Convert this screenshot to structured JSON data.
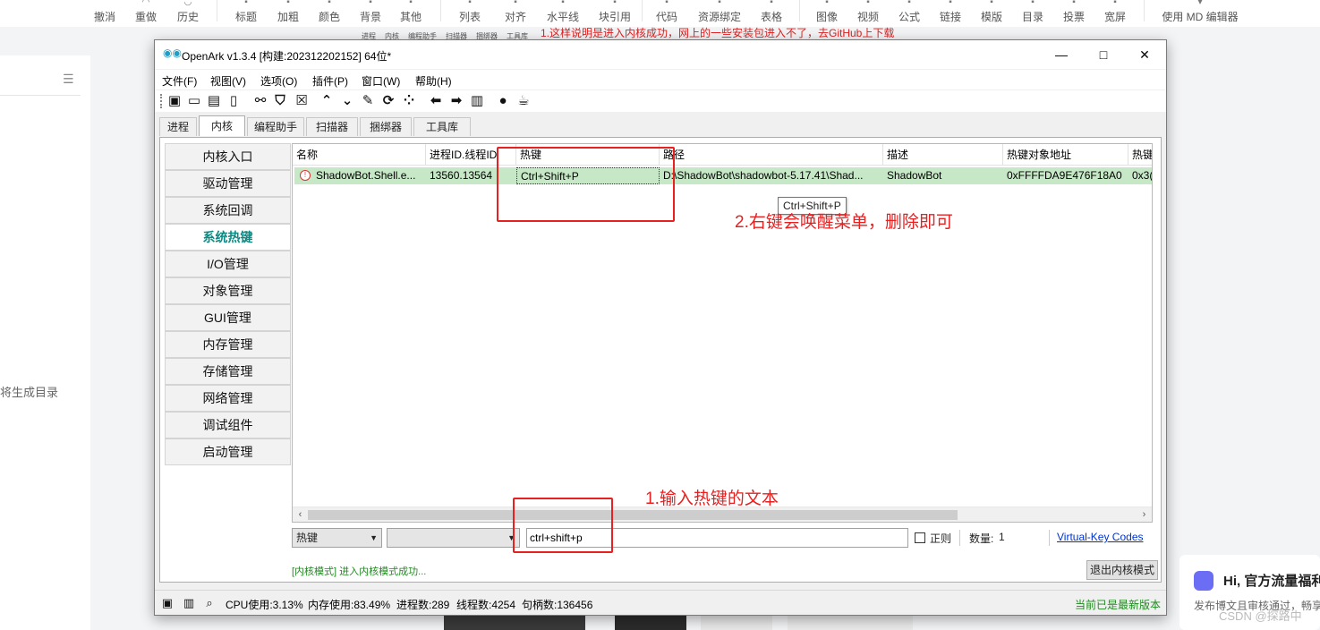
{
  "editor": {
    "tools_left": [
      "撤消",
      "重做",
      "历史"
    ],
    "tools_mid": [
      "标题",
      "加粗",
      "颜色",
      "背景",
      "其他"
    ],
    "tools_mid2": [
      "列表",
      "对齐",
      "水平线",
      "块引用"
    ],
    "tools_mid3": [
      "代码",
      "资源绑定",
      "表格"
    ],
    "tools_right": [
      "图像",
      "视频",
      "公式",
      "链接",
      "模版",
      "目录",
      "投票",
      "宽屏"
    ],
    "md_label": "使用 MD 编辑器",
    "toc_hint": "将生成目录",
    "top_note": "1.这样说明是进入内核成功，网上的一些安装包进入不了，去GitHub上下载",
    "mini_tabs": [
      "进程",
      "内核",
      "编程助手",
      "扫描器",
      "捆绑器",
      "工具库"
    ]
  },
  "notification": {
    "title": "Hi, 官方流量福利",
    "text": "发布博文且审核通过，畅享",
    "watermark": "CSDN @探路中"
  },
  "window": {
    "title": "OpenArk v1.3.4 [构建:202312202152]  64位*",
    "menu": [
      "文件(F)",
      "视图(V)",
      "选项(O)",
      "插件(P)",
      "窗口(W)",
      "帮助(H)"
    ],
    "tabs": [
      "进程",
      "内核",
      "编程助手",
      "扫描器",
      "捆绑器",
      "工具库"
    ],
    "active_tab": "内核",
    "sidenav": [
      "内核入口",
      "驱动管理",
      "系统回调",
      "系统热键",
      "I/O管理",
      "对象管理",
      "GUI管理",
      "内存管理",
      "存储管理",
      "网络管理",
      "调试组件",
      "启动管理"
    ],
    "active_nav": "系统热键",
    "columns": [
      "名称",
      "进程ID.线程ID",
      "热键",
      "路径",
      "描述",
      "热键对象地址",
      "热键"
    ],
    "rows": [
      {
        "name": "ShadowBot.Shell.e...",
        "pid_tid": "13560.13564",
        "hotkey": "Ctrl+Shift+P",
        "path": "D:\\ShadowBot\\shadowbot-5.17.41\\Shad...",
        "desc": "ShadowBot",
        "address": "0xFFFFDA9E476F18A0",
        "extra": "0x3("
      }
    ],
    "tooltip": "Ctrl+Shift+P",
    "filter": {
      "field": "热键",
      "second": "",
      "query": "ctrl+shift+p",
      "regex_label": "正则",
      "count_label": "数量:",
      "count": "1",
      "link": "Virtual-Key Codes"
    },
    "kernel_status": "[内核模式] 进入内核模式成功...",
    "exit_button": "退出内核模式",
    "status": {
      "cpu": "CPU使用:3.13%",
      "mem": "内存使用:83.49%",
      "procs": "进程数:289",
      "threads": "线程数:4254",
      "handles": "句柄数:136456",
      "latest": "当前已是最新版本"
    }
  },
  "annotations": {
    "right_click": "2.右键会唤醒菜单，删除即可",
    "input_hint": "1.输入热键的文本"
  },
  "colors": {
    "annotation_red": "#e82020",
    "row_highlight": "#c6e8c6",
    "active_nav": "#0b8a83",
    "status_green": "#1f8a1f"
  }
}
